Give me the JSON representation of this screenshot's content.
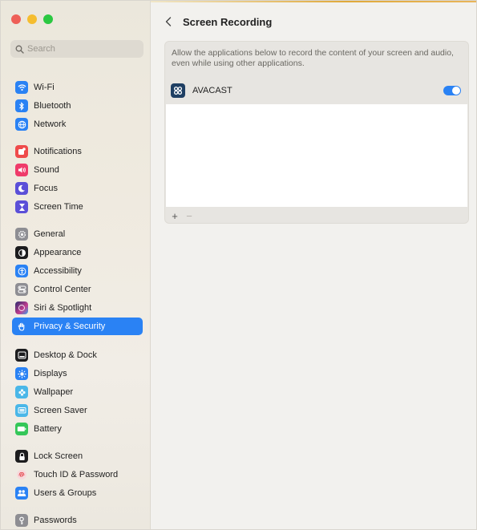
{
  "window": {
    "controls": [
      "close",
      "minimize",
      "zoom"
    ]
  },
  "search": {
    "placeholder": "Search",
    "value": ""
  },
  "sidebar": {
    "items": [
      {
        "label": "Wi-Fi",
        "icon": "wifi-icon",
        "color": "#2a82f4"
      },
      {
        "label": "Bluetooth",
        "icon": "bluetooth-icon",
        "color": "#2a82f4"
      },
      {
        "label": "Network",
        "icon": "globe-icon",
        "color": "#2a82f4"
      },
      {
        "label": "Notifications",
        "icon": "bell-icon",
        "color": "#ef4b4b"
      },
      {
        "label": "Sound",
        "icon": "speaker-icon",
        "color": "#ef3b6a"
      },
      {
        "label": "Focus",
        "icon": "moon-icon",
        "color": "#5b4fd8"
      },
      {
        "label": "Screen Time",
        "icon": "hourglass-icon",
        "color": "#5b4fd8"
      },
      {
        "label": "General",
        "icon": "gear-icon",
        "color": "#8e8e93"
      },
      {
        "label": "Appearance",
        "icon": "appearance-icon",
        "color": "#1c1c1e"
      },
      {
        "label": "Accessibility",
        "icon": "accessibility-icon",
        "color": "#2a82f4"
      },
      {
        "label": "Control Center",
        "icon": "control-center-icon",
        "color": "#8e8e93"
      },
      {
        "label": "Siri & Spotlight",
        "icon": "siri-icon",
        "color": "#3a3a8c"
      },
      {
        "label": "Privacy & Security",
        "icon": "hand-icon",
        "color": "#2a82f4",
        "active": true
      },
      {
        "label": "Desktop & Dock",
        "icon": "dock-icon",
        "color": "#1c1c1e"
      },
      {
        "label": "Displays",
        "icon": "sun-icon",
        "color": "#2a82f4"
      },
      {
        "label": "Wallpaper",
        "icon": "flower-icon",
        "color": "#4ab7e8"
      },
      {
        "label": "Screen Saver",
        "icon": "screensaver-icon",
        "color": "#4ab7e8"
      },
      {
        "label": "Battery",
        "icon": "battery-icon",
        "color": "#35c759"
      },
      {
        "label": "Lock Screen",
        "icon": "lock-icon",
        "color": "#1c1c1e"
      },
      {
        "label": "Touch ID & Password",
        "icon": "fingerprint-icon",
        "color": "#ef4b4b"
      },
      {
        "label": "Users & Groups",
        "icon": "users-icon",
        "color": "#2a82f4"
      },
      {
        "label": "Passwords",
        "icon": "key-icon",
        "color": "#8e8e93"
      }
    ]
  },
  "main": {
    "back_icon": "chevron-left-icon",
    "title": "Screen Recording",
    "description": "Allow the applications below to record the content of your screen and audio, even while using other applications.",
    "apps": [
      {
        "name": "AVACAST",
        "enabled": true
      }
    ],
    "footer": {
      "add": "+",
      "remove": "−"
    }
  },
  "colors": {
    "accent": "#2a82f4"
  }
}
